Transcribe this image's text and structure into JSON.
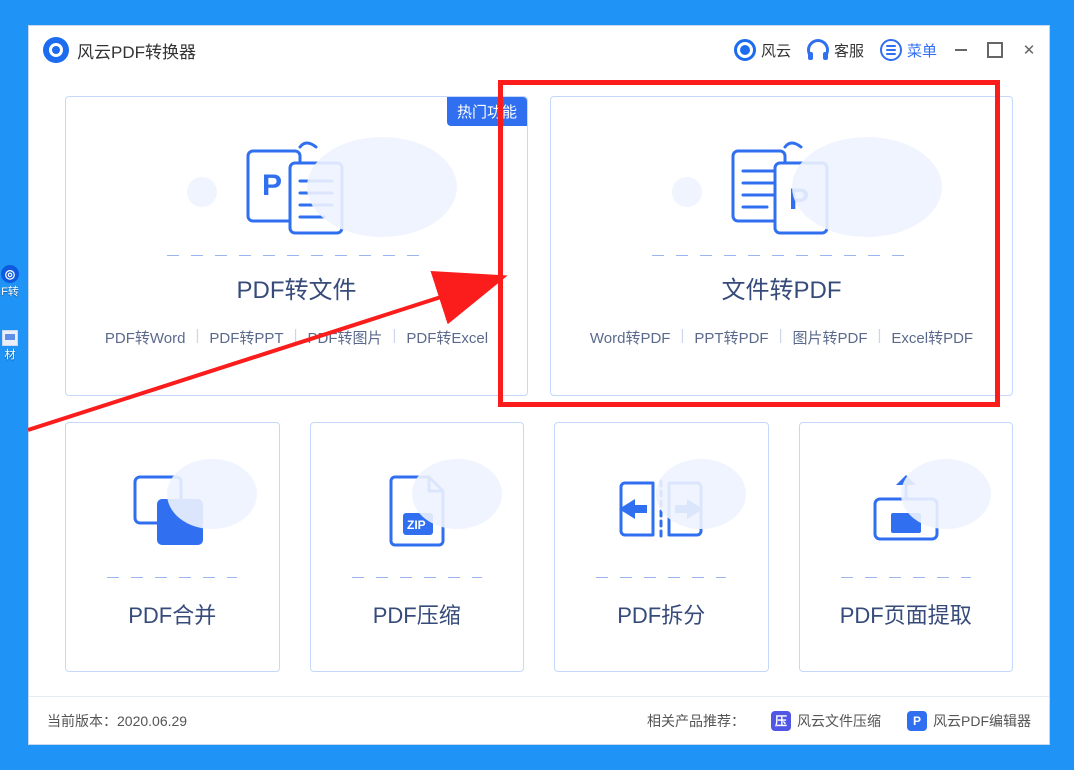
{
  "app": {
    "title": "风云PDF转换器"
  },
  "titlebar": {
    "fengyun": "风云",
    "kefu": "客服",
    "menu": "菜单"
  },
  "cards": {
    "pdf_to_file": {
      "title": "PDF转文件",
      "badge": "热门功能",
      "subs": [
        "PDF转Word",
        "PDF转PPT",
        "PDF转图片",
        "PDF转Excel"
      ]
    },
    "file_to_pdf": {
      "title": "文件转PDF",
      "subs": [
        "Word转PDF",
        "PPT转PDF",
        "图片转PDF",
        "Excel转PDF"
      ]
    },
    "merge": {
      "title": "PDF合并"
    },
    "compress": {
      "title": "PDF压缩"
    },
    "split": {
      "title": "PDF拆分"
    },
    "extract": {
      "title": "PDF页面提取"
    }
  },
  "footer": {
    "version_label": "当前版本：",
    "version": "2020.06.29",
    "related_label": "相关产品推荐：",
    "product1": "风云文件压缩",
    "product2": "风云PDF编辑器"
  },
  "desktop": {
    "shortcut1": "F转",
    "shortcut2": "材"
  }
}
